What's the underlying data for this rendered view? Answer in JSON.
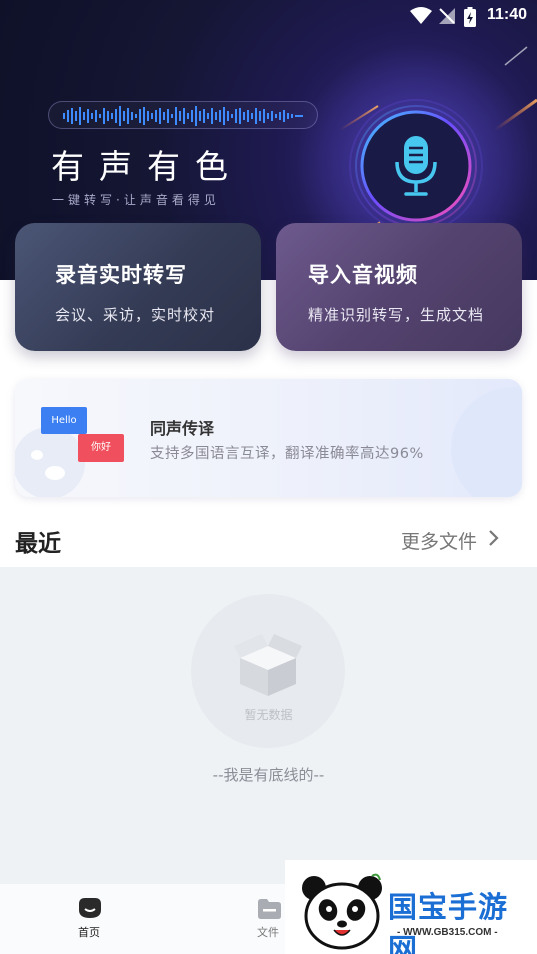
{
  "status_bar": {
    "time": "11:40"
  },
  "hero": {
    "title": "有声有色",
    "subtitle": "一键转写·让声音看得见"
  },
  "cards": [
    {
      "title": "录音实时转写",
      "subtitle": "会议、采访，实时校对"
    },
    {
      "title": "导入音视频",
      "subtitle": "精准识别转写，生成文档"
    }
  ],
  "banner": {
    "title": "同声传译",
    "subtitle": "支持多国语言互译，翻译准确率高达96%",
    "tag_hello": "Hello",
    "tag_nihao": "你好"
  },
  "recent": {
    "title": "最近",
    "more_label": "更多文件"
  },
  "empty_state": {
    "text": "暂无数据",
    "bottom_line": "--我是有底线的--"
  },
  "tabbar": {
    "tabs": [
      {
        "label": "首页",
        "active": true
      },
      {
        "label": "文件",
        "active": false
      }
    ]
  },
  "watermark": {
    "name": "国宝手游网",
    "url": "- WWW.GB315.COM -"
  },
  "colors": {
    "hero_bg": "#141633",
    "accent_blue": "#3b7ff2",
    "accent_red": "#f0505d",
    "mic_cyan": "#47c7f0",
    "watermark_blue": "#1b6fd4"
  }
}
